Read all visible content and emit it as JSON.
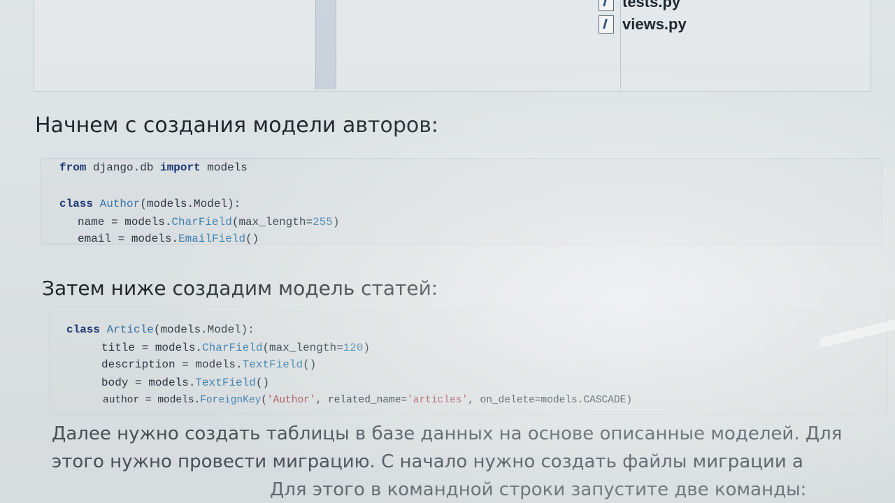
{
  "file_tree": {
    "items": [
      "tests.py",
      "views.py"
    ]
  },
  "sections": {
    "authors_heading": "Начнем с создания модели авторов:",
    "articles_heading": "Затем ниже создадим модель статей:"
  },
  "code_authors": {
    "line1": {
      "kw1": "from",
      "mod": " django.db ",
      "kw2": "import",
      "rest": " models"
    },
    "line3": {
      "kw": "class",
      "cls": "Author",
      "rest": "(models.Model):"
    },
    "line4": {
      "pre": "name = models.",
      "fn": "CharField",
      "mid": "(max_length=",
      "num": "255",
      "post": ")"
    },
    "line5": {
      "pre": "email = models.",
      "fn": "EmailField",
      "post": "()"
    }
  },
  "code_articles": {
    "line1": {
      "kw": "class",
      "cls": "Article",
      "rest": "(models.Model):"
    },
    "line2": {
      "pre": "title = models.",
      "fn": "CharField",
      "mid": "(max_length=",
      "num": "120",
      "post": ")"
    },
    "line3": {
      "pre": "description = models.",
      "fn": "TextField",
      "post": "()"
    },
    "line4": {
      "pre": "body = models.",
      "fn": "TextField",
      "post": "()"
    },
    "line5": {
      "pre": "author = models.",
      "fn": "ForeignKey",
      "p1": "(",
      "s1": "'Author'",
      "p2": ", related_name=",
      "s2": "'articles'",
      "p3": ", on_delete=models.CASCADE)"
    }
  },
  "paragraph": {
    "line1": "Далее нужно создать таблицы в базе данных на основе описанные моделей. Для",
    "line2": "этого нужно провести миграцию. С начало нужно создать файлы миграции а",
    "line3": "Для этого в командной строки запустите две команды:"
  }
}
